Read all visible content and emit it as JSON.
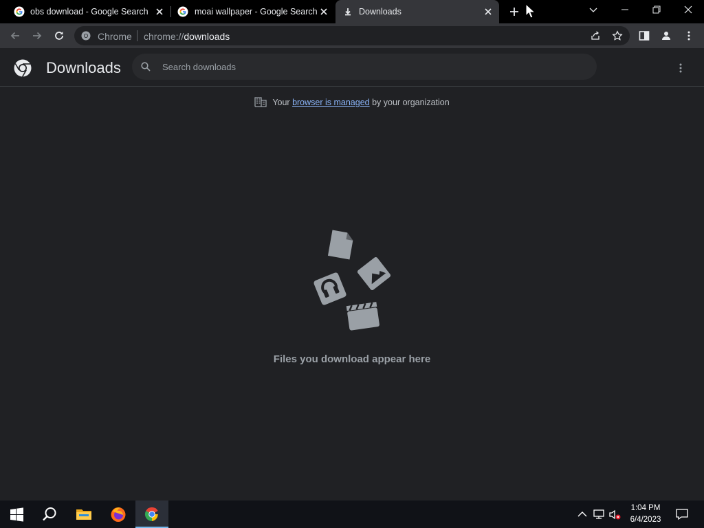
{
  "tabs": [
    {
      "title": "obs download - Google Search",
      "favicon": "google-icon",
      "active": false
    },
    {
      "title": "moai wallpaper - Google Search",
      "favicon": "google-icon",
      "active": false
    },
    {
      "title": "Downloads",
      "favicon": "download-icon",
      "active": true
    }
  ],
  "omnibox": {
    "chip": "Chrome",
    "scheme": "chrome://",
    "path": "downloads"
  },
  "downloads": {
    "title": "Downloads",
    "search_placeholder": "Search downloads",
    "managed_prefix": "Your",
    "managed_link": "browser is managed",
    "managed_suffix": "by your organization",
    "empty_message": "Files you download appear here"
  },
  "taskbar": {
    "time": "1:04 PM",
    "date": "6/4/2023",
    "apps": [
      "start-icon",
      "search-icon",
      "file-explorer-icon",
      "firefox-icon",
      "chrome-icon"
    ]
  },
  "colors": {
    "background": "#202124",
    "toolbar": "#35363a",
    "link": "#8ab4f8",
    "taskbar": "#101217"
  }
}
